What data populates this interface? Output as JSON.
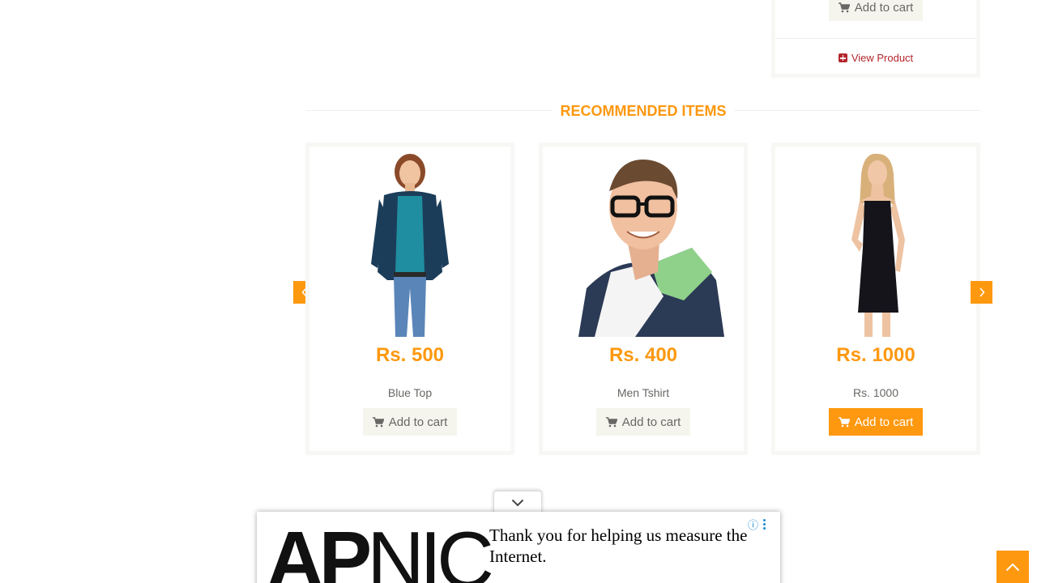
{
  "top_card": {
    "add_to_cart_label": "Add to cart",
    "view_product_label": "View Product"
  },
  "section": {
    "title": "RECOMMENDED ITEMS"
  },
  "recommended_items": [
    {
      "price": "Rs. 500",
      "name": "Blue Top",
      "add_to_cart_label": "Add to cart",
      "image": "woman-blue-top"
    },
    {
      "price": "Rs. 400",
      "name": "Men Tshirt",
      "add_to_cart_label": "Add to cart",
      "image": "man-tshirt"
    },
    {
      "price": "Rs. 1000",
      "name": "Rs. 1000",
      "add_to_cart_label": "Add to cart",
      "image": "woman-black-dress"
    }
  ],
  "carousel": {
    "prev_icon": "chevron-left-icon",
    "next_icon": "chevron-right-icon"
  },
  "ad": {
    "logo_text_bold": "AP",
    "logo_text_light": "NIC",
    "message": "Thank you for helping us measure the Internet.",
    "info_icon": "ⓘ"
  },
  "colors": {
    "accent": "#fe980f",
    "text": "#696763",
    "view_product": "#b3272d",
    "button_bg": "#f5f5ed"
  }
}
